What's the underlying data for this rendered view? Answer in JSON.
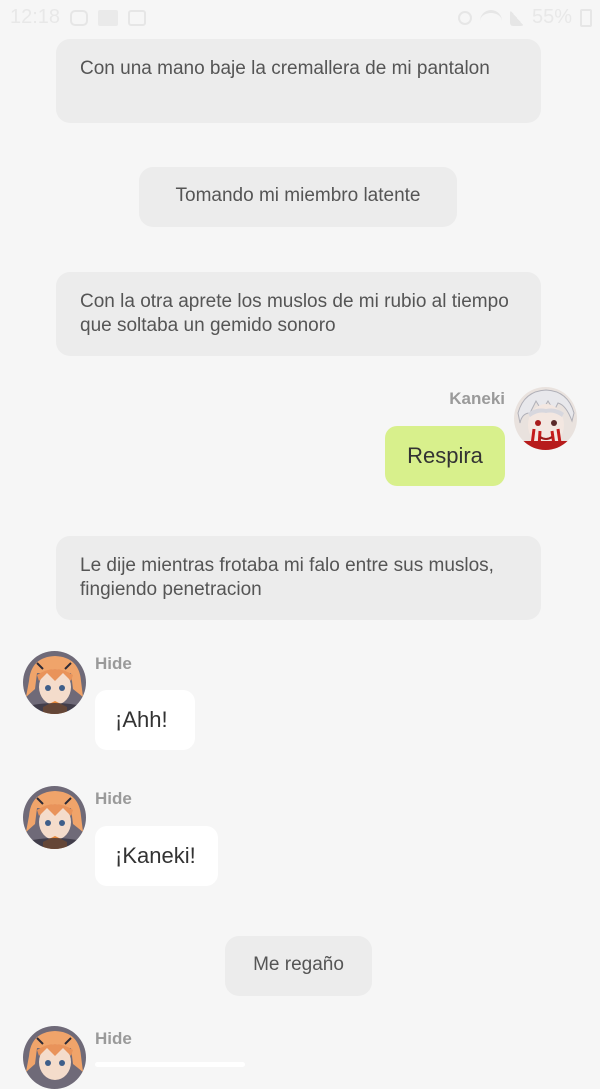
{
  "status_bar": {
    "time": "12:18",
    "battery": "55%",
    "icons": [
      "instagram-icon",
      "folder-icon",
      "gallery-icon",
      "mute-icon",
      "wifi-icon",
      "signal-icon",
      "battery-icon"
    ]
  },
  "messages": [
    {
      "type": "narration",
      "text": "Con una mano baje la cremallera de mi pantalon"
    },
    {
      "type": "narration",
      "text": "Tomando mi miembro latente"
    },
    {
      "type": "narration",
      "text": "Con la otra aprete los muslos de mi rubio al tiempo que soltaba un gemido sonoro"
    },
    {
      "type": "sent",
      "sender": "Kaneki",
      "text": "Respira"
    },
    {
      "type": "narration",
      "text": "Le dije mientras frotaba mi falo entre sus muslos, fingiendo penetracion"
    },
    {
      "type": "received",
      "sender": "Hide",
      "text": "¡Ahh!"
    },
    {
      "type": "received",
      "sender": "Hide",
      "text": "¡Kaneki!"
    },
    {
      "type": "narration",
      "text": "Me regaño"
    },
    {
      "type": "received",
      "sender": "Hide",
      "text": ""
    }
  ],
  "colors": {
    "background": "#f6f6f6",
    "narration_bubble": "#ececec",
    "sent_bubble": "#d8f08c",
    "received_bubble": "#ffffff",
    "sender_name": "#9a9a9a"
  }
}
